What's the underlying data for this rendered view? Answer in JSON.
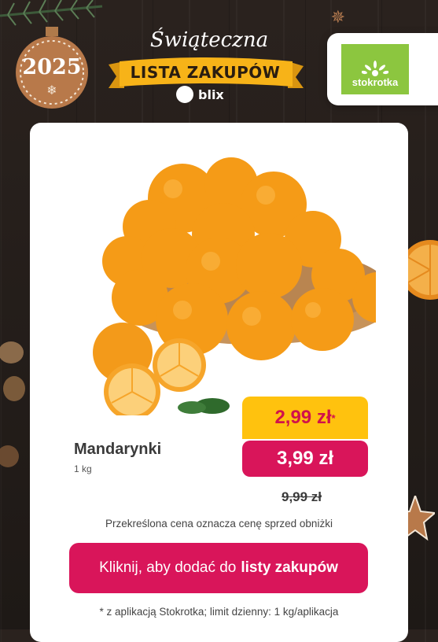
{
  "ornament": {
    "year": "2025"
  },
  "banner": {
    "script": "Świąteczna",
    "title": "LISTA ZAKUPÓW",
    "brand": "blix"
  },
  "store": {
    "name": "stokrotka",
    "color": "#8cc63f"
  },
  "product": {
    "name": "Mandarynki",
    "unit": "1 kg",
    "image_icon": "tangerines-in-bowl"
  },
  "prices": {
    "promo": "2,99 zł",
    "promo_mark": "*",
    "regular": "3,99 zł",
    "crossed": "9,99 zł"
  },
  "note": "Przekreślona cena oznacza cenę sprzed obniżki",
  "cta": {
    "prefix": "Kliknij, aby dodać do",
    "bold": "listy zakupów"
  },
  "footnote": "* z aplikacją Stokrotka; limit dzienny: 1 kg/aplikacja",
  "colors": {
    "accent": "#d9155a",
    "promo_bg": "#ffc20e",
    "ribbon": "#f7b318"
  }
}
